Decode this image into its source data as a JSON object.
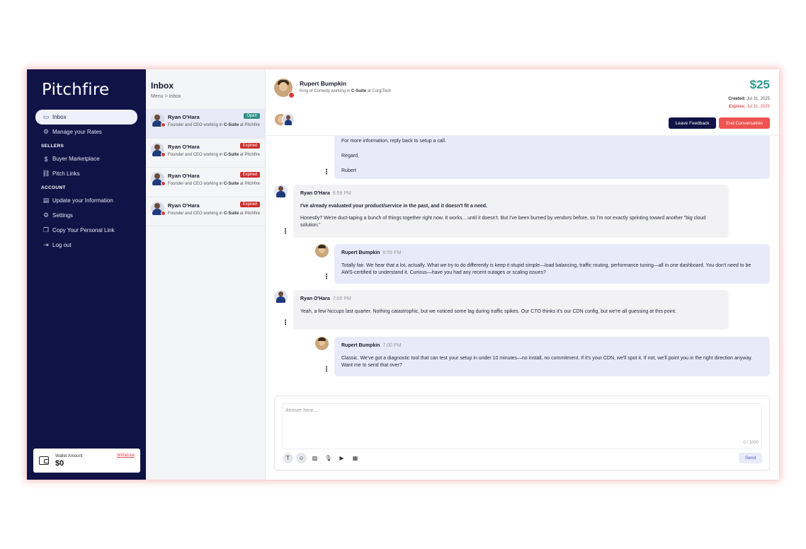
{
  "sidebar": {
    "logo": "Pitchfire",
    "items_top": [
      {
        "label": "Inbox",
        "icon": "inbox-icon",
        "glyph": "▭",
        "active": true
      },
      {
        "label": "Manage your Rates",
        "icon": "gear-icon",
        "glyph": "⚙",
        "active": false
      }
    ],
    "section_sellers": "SELLERS",
    "items_sellers": [
      {
        "label": "Buyer Marketplace",
        "icon": "dollar-icon",
        "glyph": "$"
      },
      {
        "label": "Pitch Links",
        "icon": "link-icon",
        "glyph": "⛓"
      }
    ],
    "section_account": "ACCOUNT",
    "items_account": [
      {
        "label": "Update your Information",
        "icon": "profile-card-icon",
        "glyph": "▤"
      },
      {
        "label": "Settings",
        "icon": "gear-icon",
        "glyph": "⚙"
      },
      {
        "label": "Copy Your Personal Link",
        "icon": "copy-icon",
        "glyph": "❐"
      },
      {
        "label": "Log out",
        "icon": "logout-icon",
        "glyph": "⇥"
      }
    ],
    "wallet": {
      "label": "Wallet Amount",
      "amount": "$0",
      "withdraw": "Withdraw"
    }
  },
  "inbox": {
    "title": "Inbox",
    "breadcrumb": "Menu  >  Inbox",
    "conversations": [
      {
        "name": "Ryan O'Hara",
        "sub_prefix": "Founder and CEO working in ",
        "sub_bold": "C-Suite",
        "sub_suffix": " at Pitchfire",
        "status": "Open",
        "selected": true
      },
      {
        "name": "Ryan O'Hara",
        "sub_prefix": "Founder and CEO working in ",
        "sub_bold": "C-Suite",
        "sub_suffix": " at Pitchfire",
        "status": "Expired",
        "selected": false
      },
      {
        "name": "Ryan O'Hara",
        "sub_prefix": "Founder and CEO working in ",
        "sub_bold": "C-Suite",
        "sub_suffix": " at Pitchfire",
        "status": "Expired",
        "selected": false
      },
      {
        "name": "Ryan O'Hara",
        "sub_prefix": "Founder and CEO working in ",
        "sub_bold": "C-Suite",
        "sub_suffix": " at Pitchfire",
        "status": "Expired",
        "selected": false
      }
    ]
  },
  "chat": {
    "contact_name": "Rupert Bumpkin",
    "contact_sub_prefix": "King of Comedy working in ",
    "contact_sub_bold": "C-Suite",
    "contact_sub_suffix": " at CorgiTech",
    "price": "$25",
    "created_label": "Created:",
    "created_date": "Jul 31, 2025",
    "expires_label": "Expires:",
    "expires_date": "Jul 31, 2025",
    "leave_feedback": "Leave Feedback",
    "end_conversation": "End Conversation",
    "messages": [
      {
        "sender": "Rupert Bumpkin",
        "time": "",
        "mine": true,
        "paragraphs": [
          "For more information, reply back to setup a call.",
          "Regard,",
          "Rubert"
        ]
      },
      {
        "sender": "Ryan O'Hara",
        "time": "6:59 PM",
        "mine": false,
        "paragraphs": [
          "I've already evaluated your product/service in the past, and it doesn't fit a need.",
          "Honestly? We're duct-taping a bunch of things together right now. It works... until it doesn't. But I've been burned by vendors before, so I'm not exactly sprinting toward another \"big cloud solution.\""
        ]
      },
      {
        "sender": "Rupert Bumpkin",
        "time": "6:59 PM",
        "mine": true,
        "paragraphs": [
          "Totally fair. We hear that a lot, actually. What we try to do differently is keep it stupid simple—load balancing, traffic routing, performance tuning—all in one dashboard. You don't need to be AWS-certified to understand it. Curious—have you had any recent outages or scaling issues?"
        ]
      },
      {
        "sender": "Ryan O'Hara",
        "time": "7:00 PM",
        "mine": false,
        "paragraphs": [
          "Yeah, a few hiccups last quarter. Nothing catastrophic, but we noticed some lag during traffic spikes. Our CTO thinks it's our CDN config, but we're all guessing at this point."
        ]
      },
      {
        "sender": "Rupert Bumpkin",
        "time": "7:00 PM",
        "mine": true,
        "paragraphs": [
          "Classic. We've got a diagnostic tool that can test your setup in under 10 minutes—no install, no commitment. If it's your CDN, we'll spot it. If not, we'll point you in the right direction anyway. Want me to send that over?"
        ]
      }
    ],
    "composer": {
      "placeholder": "Answer here...",
      "value": "",
      "counter": "0 / 1000",
      "send": "Send",
      "tools": [
        {
          "icon": "text-format-icon",
          "glyph": "T"
        },
        {
          "icon": "emoji-icon",
          "glyph": "☺"
        },
        {
          "icon": "image-icon",
          "glyph": "▨"
        },
        {
          "icon": "microphone-icon",
          "glyph": "🎙"
        },
        {
          "icon": "video-icon",
          "glyph": "▶"
        },
        {
          "icon": "calendar-icon",
          "glyph": "▦"
        }
      ]
    }
  },
  "colors": {
    "sidebar_bg": "#0f1345",
    "accent_price": "#2a9d8f",
    "danger": "#ef5350",
    "open_badge": "#2f8f87",
    "expired_badge": "#cf2c2c",
    "my_bubble": "#e9eaf9",
    "their_bubble": "#f2f2f4"
  }
}
